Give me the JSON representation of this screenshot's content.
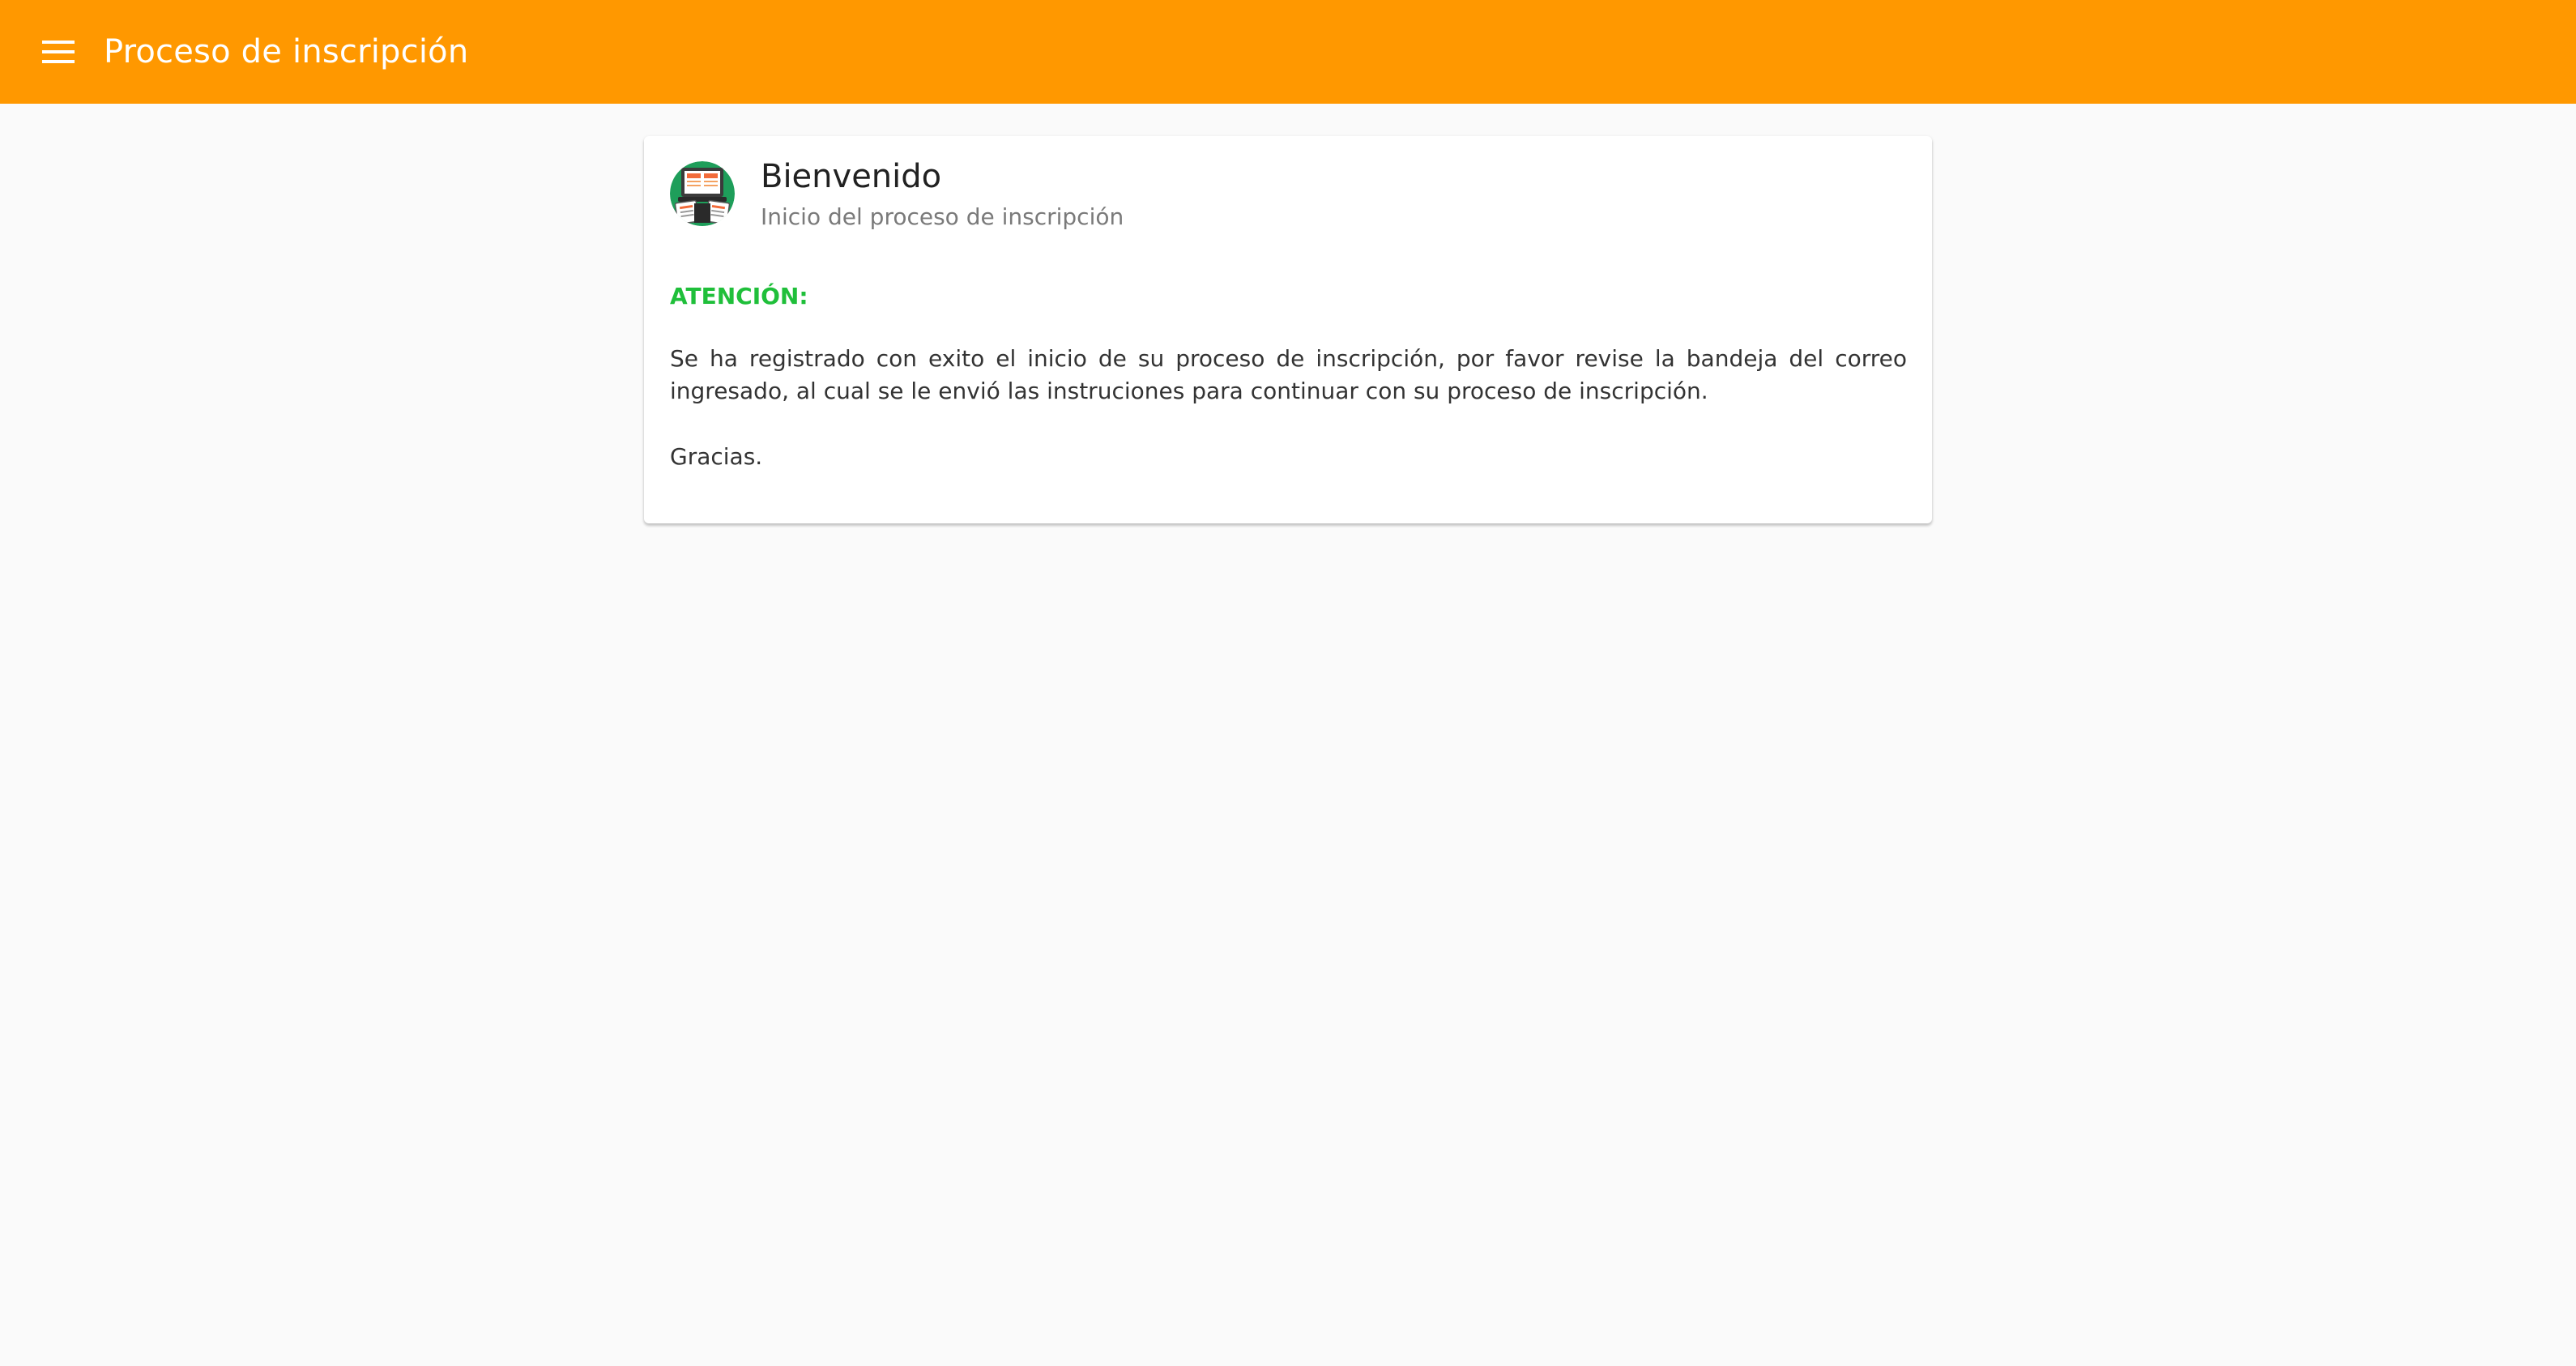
{
  "toolbar": {
    "menu_icon": "menu-icon",
    "title": "Proceso de inscripción",
    "background_color": "#ff9800"
  },
  "card": {
    "avatar_icon": "registration-form-icon",
    "title": "Bienvenido",
    "subtitle": "Inicio del proceso de inscripción",
    "attention_label": "ATENCIÓN:",
    "attention_color": "#1fbf3a",
    "message": "Se ha registrado con exito el inicio de su proceso de inscripción, por favor revise la bandeja del correo ingresado, al cual se le envió las instruciones para continuar con su proceso de inscripción.",
    "closing": "Gracias."
  }
}
